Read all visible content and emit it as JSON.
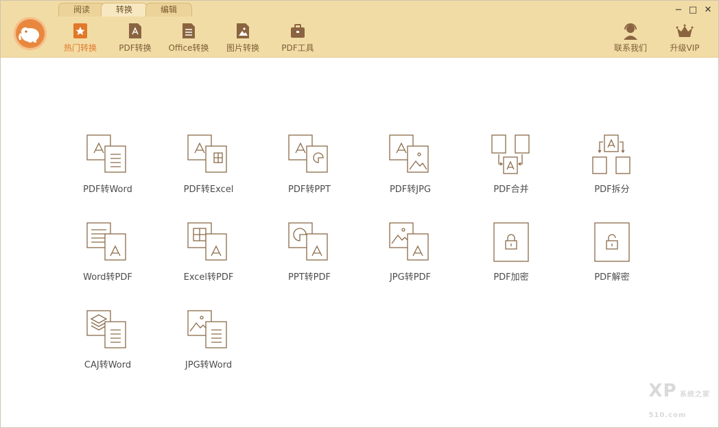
{
  "tabs": [
    {
      "label": "阅读",
      "active": false
    },
    {
      "label": "转换",
      "active": true
    },
    {
      "label": "编辑",
      "active": false
    }
  ],
  "toolbar": [
    {
      "label": "热门转换",
      "icon": "star-icon",
      "active": true
    },
    {
      "label": "PDF转换",
      "icon": "pdf-doc-icon",
      "active": false
    },
    {
      "label": "Office转换",
      "icon": "office-doc-icon",
      "active": false
    },
    {
      "label": "图片转换",
      "icon": "image-icon",
      "active": false
    },
    {
      "label": "PDF工具",
      "icon": "toolbox-icon",
      "active": false
    }
  ],
  "right_actions": [
    {
      "label": "联系我们",
      "icon": "headset-icon"
    },
    {
      "label": "升级VIP",
      "icon": "crown-icon"
    }
  ],
  "conversions": [
    {
      "label": "PDF转Word",
      "icon": "pdf-to-word-icon"
    },
    {
      "label": "PDF转Excel",
      "icon": "pdf-to-excel-icon"
    },
    {
      "label": "PDF转PPT",
      "icon": "pdf-to-ppt-icon"
    },
    {
      "label": "PDF转JPG",
      "icon": "pdf-to-jpg-icon"
    },
    {
      "label": "PDF合并",
      "icon": "pdf-merge-icon"
    },
    {
      "label": "PDF拆分",
      "icon": "pdf-split-icon"
    },
    {
      "label": "Word转PDF",
      "icon": "word-to-pdf-icon"
    },
    {
      "label": "Excel转PDF",
      "icon": "excel-to-pdf-icon"
    },
    {
      "label": "PPT转PDF",
      "icon": "ppt-to-pdf-icon"
    },
    {
      "label": "JPG转PDF",
      "icon": "jpg-to-pdf-icon"
    },
    {
      "label": "PDF加密",
      "icon": "pdf-encrypt-icon"
    },
    {
      "label": "PDF解密",
      "icon": "pdf-decrypt-icon"
    },
    {
      "label": "CAJ转Word",
      "icon": "caj-to-word-icon"
    },
    {
      "label": "JPG转Word",
      "icon": "jpg-to-word-icon"
    }
  ],
  "window_controls": {
    "minimize": "−",
    "maximize": "□",
    "close": "✕"
  },
  "colors": {
    "titlebar": "#f2dca6",
    "accent": "#e07a2a",
    "icon_stroke": "#8a6a48"
  },
  "watermark": {
    "main": "XP",
    "sub": "系统之家",
    "site": "510.com"
  }
}
